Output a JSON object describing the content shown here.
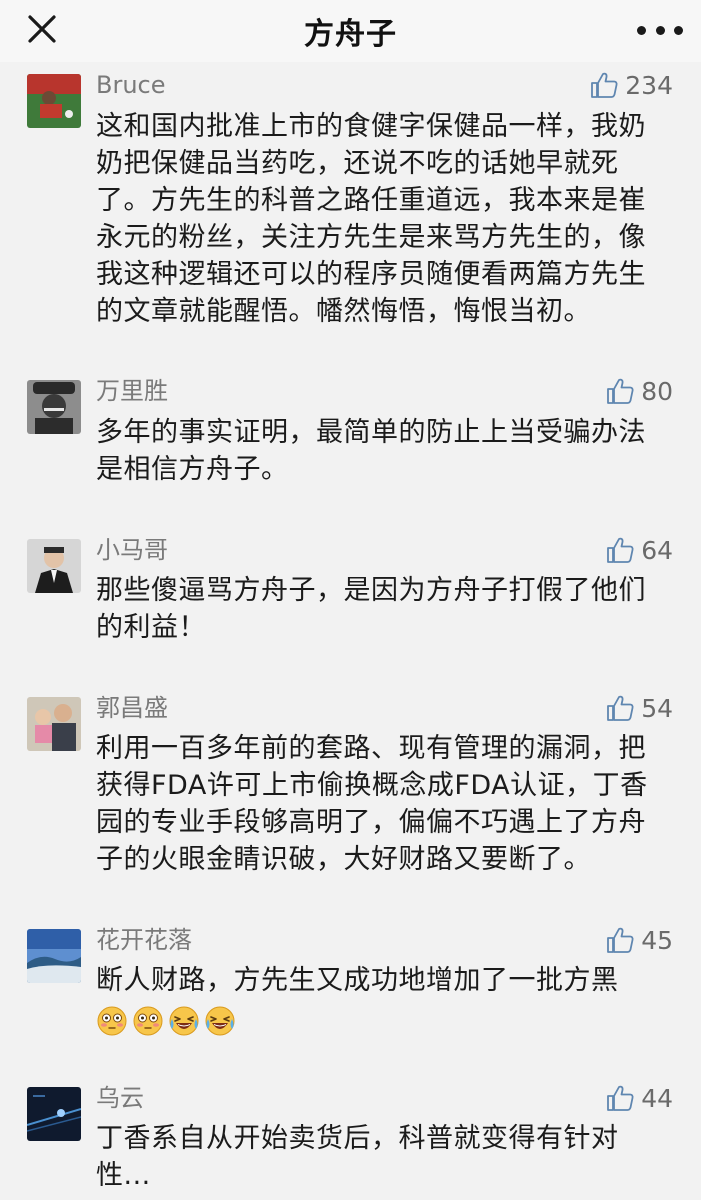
{
  "header": {
    "title": "方舟子"
  },
  "comments": [
    {
      "name": "Bruce",
      "likes": "234",
      "lines": [
        "这和国内批准上市的食健字保健品一样，我奶",
        "奶把保健品当药吃，还说不吃的话她早就死",
        "了。方先生的科普之路任重道远，我本来是崔",
        "永元的粉丝，关注方先生是来骂方先生的，像",
        "我这种逻辑还可以的程序员随便看两篇方先生",
        "的文章就能醒悟。幡然悔悟，悔恨当初。"
      ]
    },
    {
      "name": "万里胜",
      "likes": "80",
      "lines": [
        "多年的事实证明，最简单的防止上当受骗办法",
        "是相信方舟子。"
      ]
    },
    {
      "name": "小马哥",
      "likes": "64",
      "lines": [
        "那些傻逼骂方舟子，是因为方舟子打假了他们",
        "的利益！"
      ]
    },
    {
      "name": "郭昌盛",
      "likes": "54",
      "lines": [
        "利用一百多年前的套路、现有管理的漏洞，把",
        "获得FDA许可上市偷换概念成FDA认证，丁香",
        "园的专业手段够高明了，偏偏不巧遇上了方舟",
        "子的火眼金睛识破，大好财路又要断了。"
      ]
    },
    {
      "name": "花开花落",
      "likes": "45",
      "lines": [
        "断人财路，方先生又成功地增加了一批方黑"
      ],
      "emojis": [
        "flushed-face",
        "flushed-face",
        "laughing-crying-face",
        "laughing-crying-face"
      ]
    },
    {
      "name": "乌云",
      "likes": "44",
      "lines": [
        "丁香系自从开始卖货后，科普就变得有针对",
        "性..."
      ]
    }
  ],
  "colors": {
    "background": "#f2f2f2",
    "name_text": "#7a7a7a",
    "body_text": "#1b1b1b"
  }
}
